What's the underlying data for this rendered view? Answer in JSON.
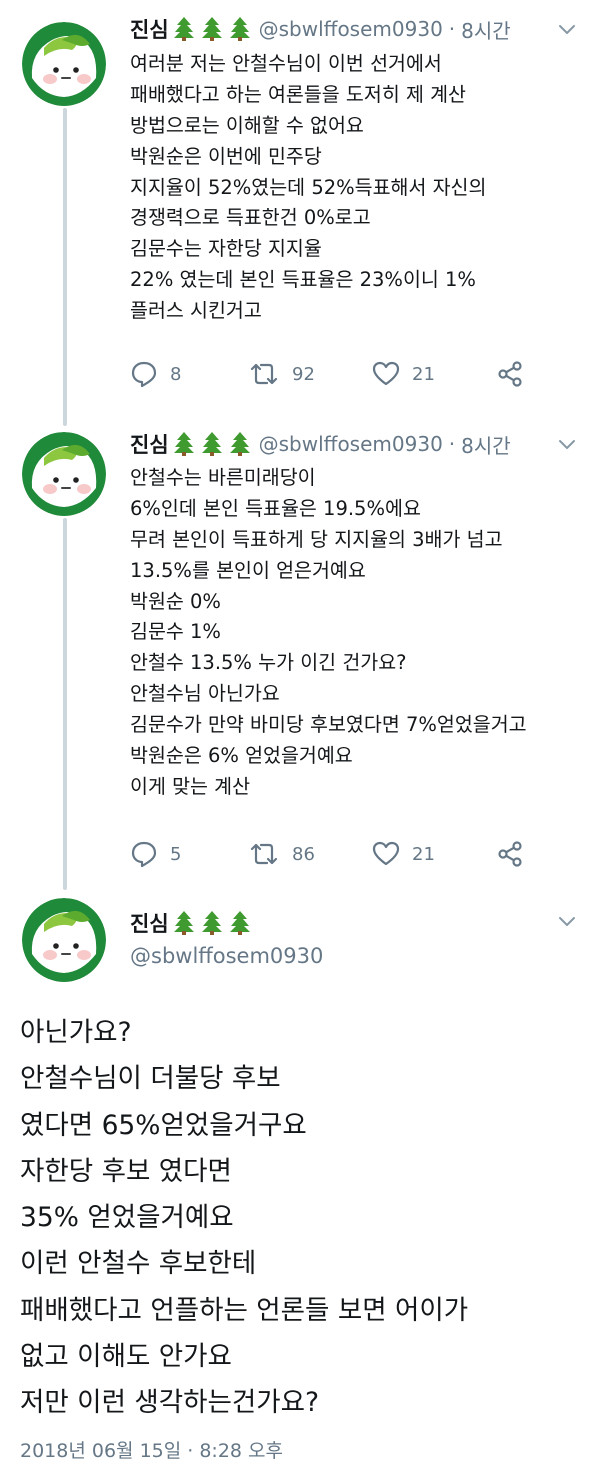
{
  "tweets": [
    {
      "name": "진심",
      "handle": "@sbwlffosem0930",
      "dot": "·",
      "time": "8시간",
      "lines": [
        "여러분 저는 안철수님이 이번 선거에서",
        "패배했다고 하는 여론들을 도저히 제 계산",
        "방법으로는 이해할 수 없어요",
        "박원순은 이번에 민주당",
        "지지율이 52%였는데 52%득표해서 자신의",
        "경쟁력으로 득표한건 0%로고",
        "김문수는 자한당 지지율",
        "22% 였는데 본인 득표율은 23%이니 1%",
        "플러스 시킨거고"
      ],
      "replies": "8",
      "retweets": "92",
      "likes": "21"
    },
    {
      "name": "진심",
      "handle": "@sbwlffosem0930",
      "dot": "·",
      "time": "8시간",
      "lines": [
        "안철수는 바른미래당이",
        "6%인데 본인 득표율은 19.5%에요",
        "무려 본인이 득표하게 당 지지율의 3배가 넘고",
        "13.5%를 본인이 얻은거예요",
        "박원순 0%",
        "김문수 1%",
        "안철수 13.5%  누가 이긴 건가요?",
        "안철수님 아닌가요",
        "김문수가 만약 바미당 후보였다면 7%얻었을거고",
        "박원순은 6% 얻었을거예요",
        "이게 맞는 계산"
      ],
      "replies": "5",
      "retweets": "86",
      "likes": "21"
    }
  ],
  "main_tweet": {
    "name": "진심",
    "handle": "@sbwlffosem0930",
    "lines": [
      "아닌가요?",
      "안철수님이 더불당 후보",
      "였다면 65%얻었을거구요",
      "자한당 후보 였다면",
      "35% 얻었을거예요",
      "이런 안철수 후보한테",
      "패배했다고 언플하는 언론들 보면 어이가",
      "없고 이해도 안가요",
      "저만 이런 생각하는건가요?"
    ],
    "date": "2018년 06월 15일 · 8:28 오후"
  },
  "icons": {
    "reply": "reply-icon",
    "retweet": "retweet-icon",
    "like": "heart-icon",
    "share": "share-icon",
    "caret": "chevron-down-icon",
    "tree": "evergreen-tree-emoji"
  },
  "colors": {
    "secondary_text": "#657786",
    "avatar_green": "#1f8a3a",
    "tree_green": "#3f9a2f",
    "thread_line": "#ccd6dd"
  }
}
